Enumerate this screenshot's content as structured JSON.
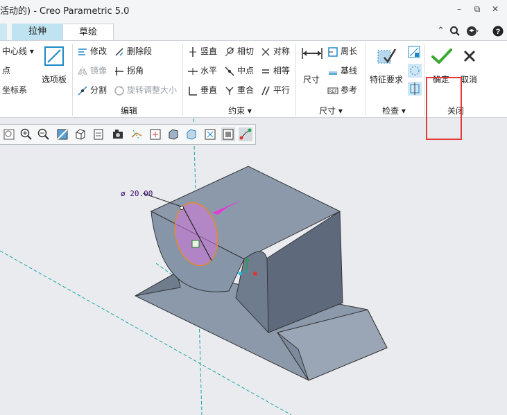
{
  "window": {
    "title": "活动的) - Creo Parametric 5.0",
    "controls": {
      "minimize": "–",
      "restore": "⧉",
      "close": "✕"
    }
  },
  "tabs": [
    {
      "label": "拉伸"
    },
    {
      "label": "草绘"
    }
  ],
  "ribbon": {
    "setup": {
      "centerline": "中心线",
      "point": "点",
      "coordsys": "坐标系",
      "palette": "选项板"
    },
    "edit": {
      "modify": "修改",
      "delete_segment": "删除段",
      "mirror": "镜像",
      "corner": "拐角",
      "divide": "分割",
      "rotate_resize": "旋转调整大小",
      "group": "编辑"
    },
    "constrain": {
      "vertical": "竖直",
      "tangent": "相切",
      "symmetric": "对称",
      "horizontal": "水平",
      "midpoint": "中点",
      "equal": "相等",
      "perpendicular": "垂直",
      "coincident": "重合",
      "parallel": "平行",
      "group": "约束"
    },
    "dimension": {
      "dimension": "尺寸",
      "perimeter": "周长",
      "baseline": "基线",
      "reference": "参考",
      "group": "尺寸"
    },
    "inspect": {
      "feature_req": "特征要求",
      "group": "检查"
    },
    "close": {
      "ok": "确定",
      "cancel": "取消",
      "group": "关闭"
    }
  },
  "canvas": {
    "dimension_text": "ø 20.00"
  },
  "colors": {
    "accent_red": "#e53935",
    "check_green": "#3aa832",
    "pink_arrow": "#e23bd8",
    "model_face": "#8c99ab",
    "cyan_axis": "#1aa6a6"
  }
}
